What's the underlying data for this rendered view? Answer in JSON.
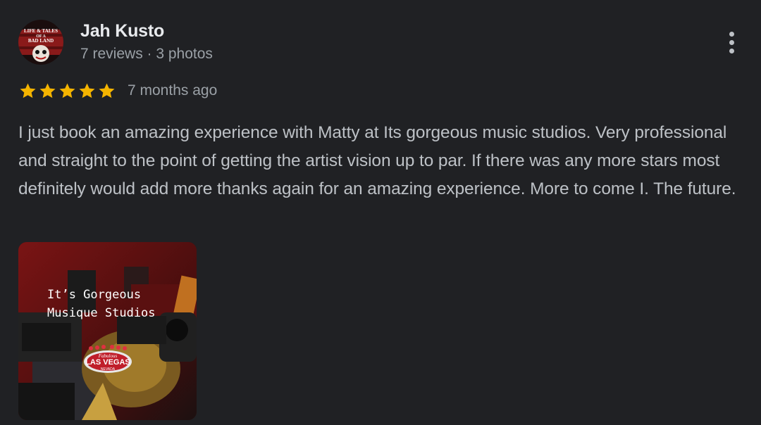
{
  "review": {
    "author": {
      "name": "Jah Kusto",
      "meta": "7 reviews · 3 photos",
      "avatar_text": [
        "LIFE & TALES",
        "OF A",
        "BAD LAND"
      ]
    },
    "rating": 5,
    "max_rating": 5,
    "date": "7 months ago",
    "text": "I just book an amazing experience with Matty at Its gorgeous music studios. Very professional and straight to the point of getting the artist vision up to par. If there was any more stars most definitely would add more thanks again for an amazing experience. More to come I. The future.",
    "photo": {
      "overlay_lines": [
        "It’s Gorgeous",
        "Musique Studios"
      ],
      "sign_text": "LAS VEGAS",
      "sign_sub": "Fabulous",
      "sign_bottom": "NEVADA"
    }
  },
  "icons": {
    "star": "star-icon",
    "more": "more-vert-icon"
  },
  "colors": {
    "background": "#202124",
    "star": "#f4b400",
    "name": "#e8eaed",
    "secondary": "#9aa0a6",
    "body": "#bdc1c6"
  }
}
